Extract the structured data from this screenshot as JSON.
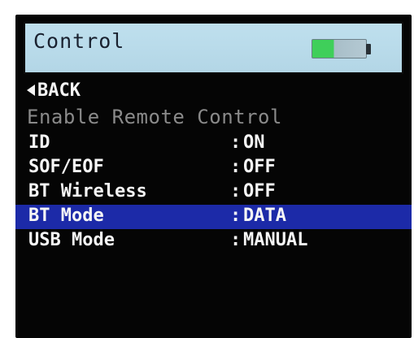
{
  "header": {
    "title": "Control",
    "battery_icon": "battery-icon",
    "battery_level": 0.4,
    "battery_fill_color": "#3fcf5a"
  },
  "nav": {
    "back_icon": "left-triangle-icon",
    "back_label": "BACK"
  },
  "menu": {
    "section_title": "Enable Remote Control",
    "separator": ":",
    "items": [
      {
        "label": "ID",
        "value": "ON"
      },
      {
        "label": "SOF/EOF",
        "value": "OFF"
      },
      {
        "label": "BT Wireless",
        "value": "OFF"
      },
      {
        "label": "BT Mode",
        "value": "DATA"
      },
      {
        "label": "USB Mode",
        "value": "MANUAL"
      }
    ],
    "selected_index": 3,
    "selection_color": "#1c2aa8"
  }
}
